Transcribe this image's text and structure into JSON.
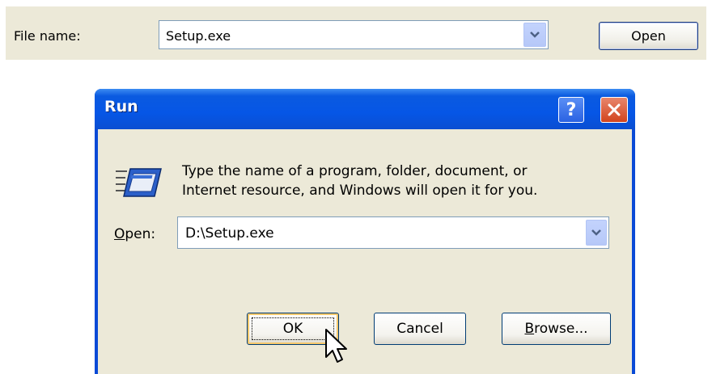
{
  "file_dialog": {
    "file_name_label": "File name:",
    "file_name_value": "Setup.exe",
    "open_button_label": "Open"
  },
  "run_dialog": {
    "title": "Run",
    "help_button_label": "?",
    "instruction_line1": "Type the name of a program, folder, document, or",
    "instruction_line2": "Internet resource, and Windows will open it for you.",
    "open_label_accel": "O",
    "open_label_rest": "pen:",
    "open_value": "D:\\Setup.exe",
    "ok_label": "OK",
    "cancel_label": "Cancel",
    "browse_accel": "B",
    "browse_rest": "rowse..."
  },
  "icons": {
    "dropdown": "chevron-down-icon",
    "close": "close-icon",
    "run": "run-program-icon",
    "cursor": "mouse-pointer-icon"
  },
  "colors": {
    "titlebar_blue": "#0656e6",
    "dialog_face": "#ece9d8",
    "close_red": "#d2441e",
    "focus_orange": "#f6c86b"
  }
}
